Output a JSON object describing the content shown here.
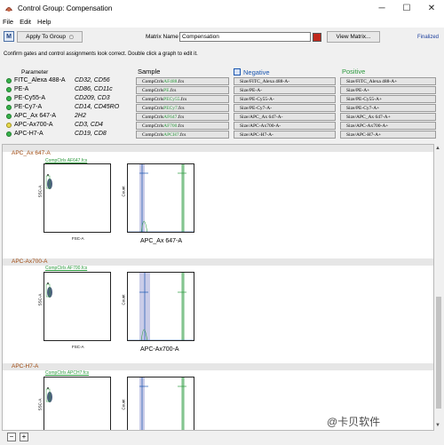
{
  "window": {
    "title": "Control Group: Compensation",
    "minimize": "─",
    "maximize": "☐",
    "close": "✕"
  },
  "menu": [
    "File",
    "Edit",
    "Help"
  ],
  "toolbar": {
    "m_label": "M",
    "apply_label": "Apply To Group",
    "matrix_name_label": "Matrix Name",
    "matrix_name_value": "Compensation",
    "view_matrix_label": "View Matrix...",
    "status": "Finalized",
    "accent": "#c0281c"
  },
  "notice": "Confirm gates and control assignments look correct. Double click a graph to edit it.",
  "headers": {
    "parameter": "Parameter",
    "sample": "Sample",
    "negative": "Negative",
    "positive": "Positive"
  },
  "rows": [
    {
      "param": "FITC_Alexa 488-A",
      "marker": "CD32, CD56",
      "status": "ok",
      "sample_prefix": "CompCtrls ",
      "sample_hl": "AF488",
      "sample_suffix": ".fcs",
      "negative": "Size/FITC_Alexa 488-A-",
      "positive": "Size/FITC_Alexa 488-A+"
    },
    {
      "param": "PE-A",
      "marker": "CD86, CD11c",
      "status": "ok",
      "sample_prefix": "CompCtrls ",
      "sample_hl": "PE",
      "sample_suffix": ".fcs",
      "negative": "Size/PE-A-",
      "positive": "Size/PE-A+"
    },
    {
      "param": "PE-Cy55-A",
      "marker": "CD209, CD3",
      "status": "ok",
      "sample_prefix": "CompCtrls ",
      "sample_hl": "PECy55",
      "sample_suffix": ".fcs",
      "negative": "Size/PE-Cy55-A-",
      "positive": "Size/PE-Cy55-A+"
    },
    {
      "param": "PE-Cy7-A",
      "marker": "CD14, CD45RO",
      "status": "ok",
      "sample_prefix": "CompCtrls ",
      "sample_hl": "PECy7",
      "sample_suffix": ".fcs",
      "negative": "Size/PE-Cy7-A-",
      "positive": "Size/PE-Cy7-A+"
    },
    {
      "param": "APC_Ax 647-A",
      "marker": "2H2",
      "status": "ok",
      "sample_prefix": "CompCtrls ",
      "sample_hl": "AF647",
      "sample_suffix": ".fcs",
      "negative": "Size/APC_Ax 647-A-",
      "positive": "Size/APC_Ax 647-A+"
    },
    {
      "param": "APC-Ax700-A",
      "marker": "CD3, CD4",
      "status": "warn",
      "sample_prefix": "CompCtrls ",
      "sample_hl": "AF700",
      "sample_suffix": ".fcs",
      "negative": "Size/APC-Ax700-A-",
      "positive": "Size/APC-Ax700-A+"
    },
    {
      "param": "APC-H7-A",
      "marker": "CD19, CD8",
      "status": "ok",
      "sample_prefix": "CompCtrls ",
      "sample_hl": "APCH7",
      "sample_suffix": ".fcs",
      "negative": "Size/APC-H7-A-",
      "positive": "Size/APC-H7-A+"
    }
  ],
  "sections": [
    {
      "title": "APC_Ax 647-A",
      "file": "CompCtrls AF647.fcs",
      "xlabel": "FSC-A",
      "ylabel": "SSC-A",
      "hist_label": "APC_Ax 647-A",
      "neg_label": "Size/APC_Ax 647-A-",
      "pos_label": "Size/APC_Ax 647-A+"
    },
    {
      "title": "APC-Ax700-A",
      "file": "CompCtrls AF700.fcs",
      "xlabel": "FSC-A",
      "ylabel": "SSC-A",
      "hist_label": "APC-Ax700-A",
      "neg_label": "Size/APC-Ax700-A-",
      "pos_label": "Size/APC-Ax700-A+"
    },
    {
      "title": "APC-H7-A",
      "file": "CompCtrls APCH7.fcs",
      "xlabel": "",
      "ylabel": "SSC-A",
      "hist_label": "",
      "neg_label": "Size/APC-H7-A-",
      "pos_label": "Size/APC-H7-A+"
    }
  ],
  "zoom": {
    "out": "−",
    "in": "+"
  },
  "watermark": "@卡贝软件",
  "colors": {
    "green": "#2c9a3e",
    "gate_band": "#9fa3d6",
    "negative_header": "#1a56b0",
    "positive_header": "#2c9a3e",
    "section_title": "#a04a10"
  }
}
